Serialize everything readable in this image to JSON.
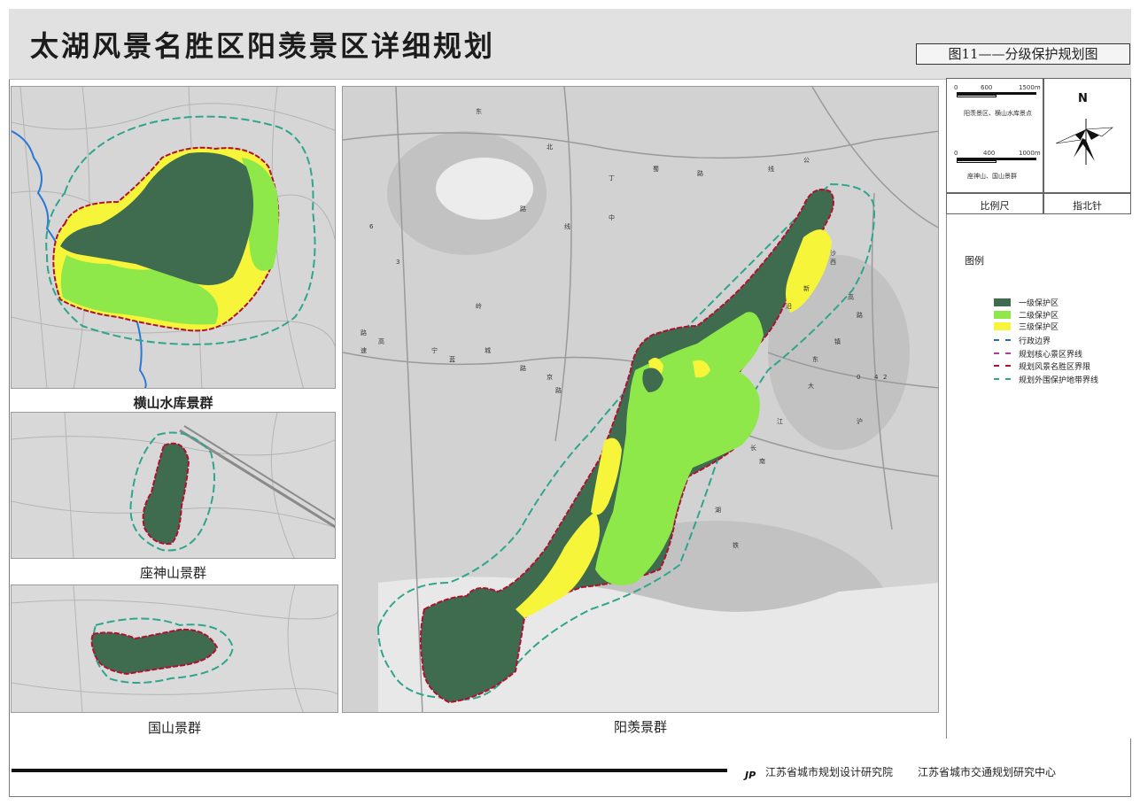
{
  "title": "太湖风景名胜区阳羡景区详细规划",
  "figure_label": "图11——分级保护规划图",
  "panels": {
    "hengshan": "横山水库景群",
    "zuoshen": "座神山景群",
    "guoshan": "国山景群",
    "yangxian": "阳羡景群"
  },
  "scale_bars": [
    {
      "ticks": [
        "0",
        "600",
        "1500m"
      ],
      "caption": "阳羡景区、横山水库景点"
    },
    {
      "ticks": [
        "0",
        "400",
        "1000m"
      ],
      "caption": "座神山、国山景群"
    }
  ],
  "north_arrow": {
    "letter": "N",
    "icon": "north-arrow-icon"
  },
  "sidebar_captions": {
    "scale": "比例尺",
    "north": "指北针"
  },
  "legend": {
    "title": "图例",
    "items": [
      {
        "label": "一级保护区",
        "kind": "fill",
        "color": "#3f6b4e"
      },
      {
        "label": "二级保护区",
        "kind": "fill",
        "color": "#8ee84a"
      },
      {
        "label": "三级保护区",
        "kind": "fill",
        "color": "#f6f53a"
      },
      {
        "label": "行政边界",
        "kind": "dash",
        "color": "#2a6f9a"
      },
      {
        "label": "规划核心景区界线",
        "kind": "dash",
        "color": "#b33aa0"
      },
      {
        "label": "规划风景名胜区界限",
        "kind": "dash",
        "color": "#b01030"
      },
      {
        "label": "规划外围保护地带界线",
        "kind": "dash",
        "color": "#2fa58a"
      }
    ]
  },
  "map_road_labels": [
    "东",
    "北",
    "丁",
    "蜀",
    "路",
    "线",
    "公",
    "沙",
    "新",
    "路",
    "镇",
    "大",
    "江",
    "南",
    "湖",
    "岭",
    "蓝",
    "城",
    "路",
    "3",
    "6",
    "0",
    "4",
    "2",
    "高",
    "速",
    "高",
    "路",
    "京",
    "路",
    "西",
    "沿",
    "长",
    "沪",
    "铁",
    "中",
    "线",
    "路",
    "宁",
    "东"
  ],
  "footer": {
    "logo": "JP",
    "org1": "江苏省城市规划设计研究院",
    "org2": "江苏省城市交通规划研究中心"
  }
}
